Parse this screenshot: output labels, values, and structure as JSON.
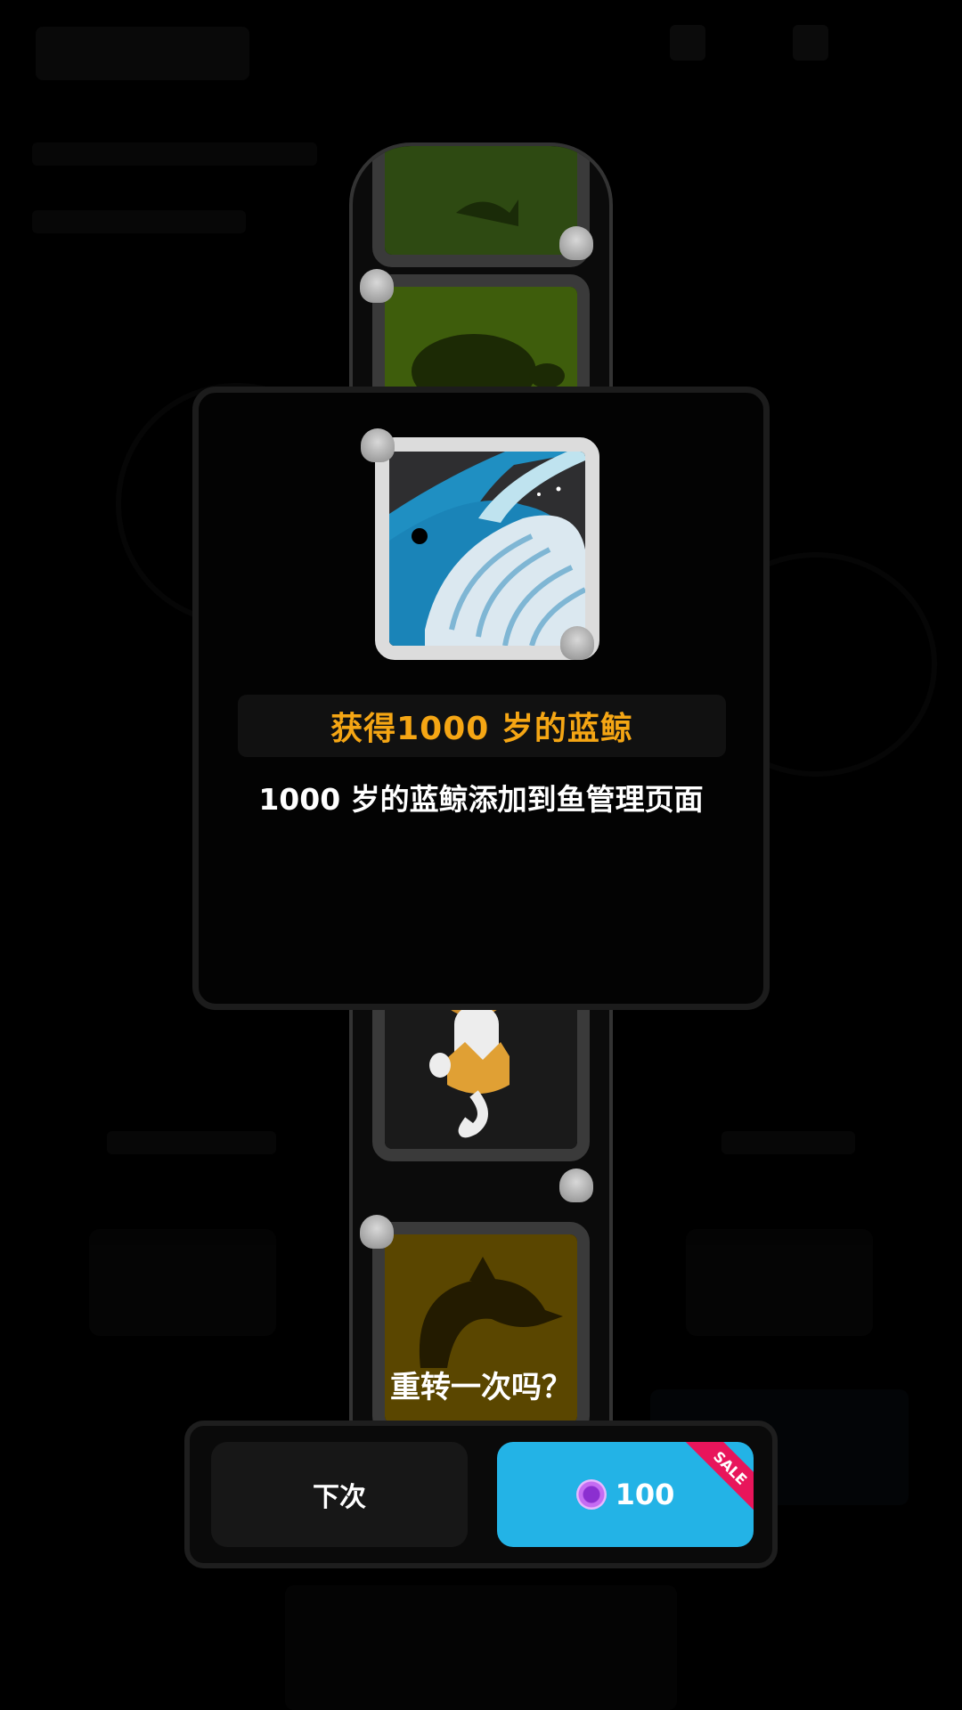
{
  "modal": {
    "reward_title": "获得1000 岁的蓝鲸",
    "reward_description": "1000 岁的蓝鲸添加到鱼管理页面",
    "reward_icon": "blue-whale-icon"
  },
  "slot_reel": {
    "visible_icons": [
      "green-fish-icon",
      "turtle-icon",
      "seahorse-icon",
      "dolphin-icon"
    ]
  },
  "respin": {
    "question": "重转一次吗？",
    "next_button_label": "下次",
    "respin_cost": "100",
    "sale_badge": "SALE",
    "currency_icon": "purple-pearl-icon"
  },
  "colors": {
    "reward_title": "#f5a614",
    "respin_button": "#23b3e6",
    "sale_badge": "#e8155b"
  }
}
